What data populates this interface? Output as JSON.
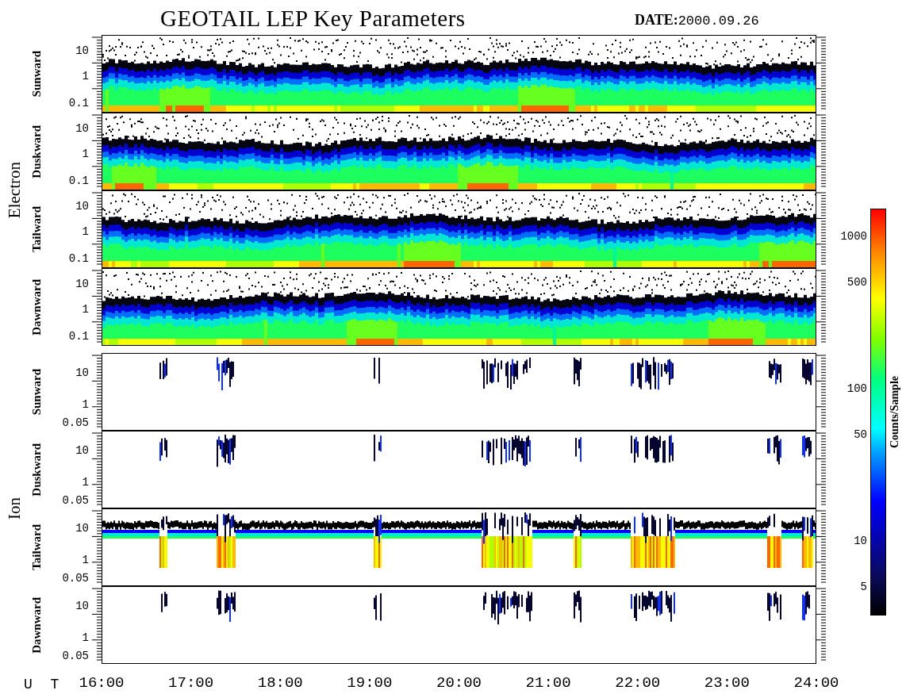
{
  "title": "GEOTAIL LEP Key Parameters",
  "date": {
    "label": "DATE:",
    "value": "2000.09.26"
  },
  "groups": [
    {
      "name": "Electron",
      "kind": "electron",
      "panels": [
        {
          "label": "Sunward",
          "ticks": [
            "10",
            "1",
            "0.1"
          ]
        },
        {
          "label": "Duskward",
          "ticks": [
            "10",
            "1",
            "0.1"
          ]
        },
        {
          "label": "Tailward",
          "ticks": [
            "10",
            "1",
            "0.1"
          ]
        },
        {
          "label": "Dawnward",
          "ticks": [
            "10",
            "1",
            "0.1"
          ]
        }
      ]
    },
    {
      "name": "Ion",
      "kind": "ion",
      "panels": [
        {
          "label": "Sunward",
          "ticks": [
            "10",
            "1",
            "0.05"
          ]
        },
        {
          "label": "Duskward",
          "ticks": [
            "10",
            "1",
            "0.05"
          ]
        },
        {
          "label": "Tailward",
          "ticks": [
            "10",
            "1",
            "0.05"
          ]
        },
        {
          "label": "Dawnward",
          "ticks": [
            "10",
            "1",
            "0.05"
          ]
        }
      ]
    }
  ],
  "time_axis": {
    "label": "U T",
    "ticks": [
      "16:00",
      "17:00",
      "18:00",
      "19:00",
      "20:00",
      "21:00",
      "22:00",
      "23:00",
      "24:00"
    ]
  },
  "colorbar": {
    "label": "Counts/Sample",
    "ticks": [
      "1000",
      "500",
      "100",
      "50",
      "10",
      "5"
    ]
  }
}
